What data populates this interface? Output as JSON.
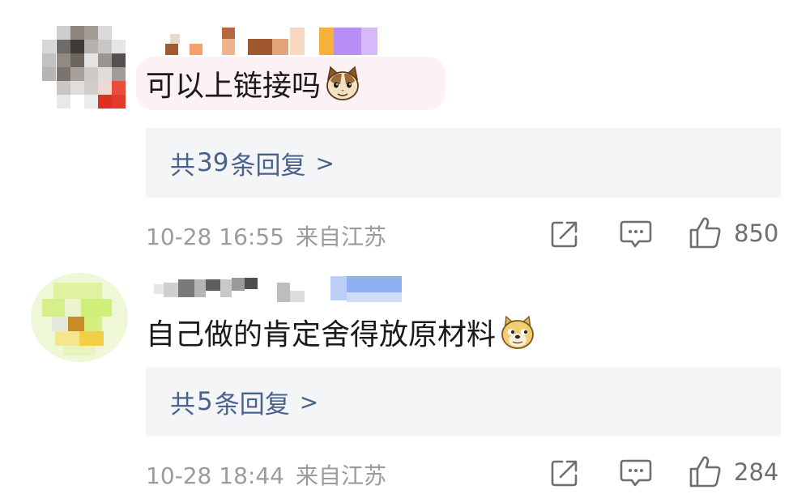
{
  "comments": [
    {
      "text": "可以上链接吗",
      "emoji": "cat-face-emoji",
      "replies_prefix": "共",
      "replies_count": "39",
      "replies_suffix": "条回复",
      "replies_chevron": ">",
      "time": "10-28 16:55",
      "location": "来自江苏",
      "likes": "850"
    },
    {
      "text": "自己做的肯定舍得放原材料",
      "emoji": "doge-face-emoji",
      "replies_prefix": "共",
      "replies_count": "5",
      "replies_suffix": "条回复",
      "replies_chevron": ">",
      "time": "10-28 18:44",
      "location": "来自江苏",
      "likes": "284"
    }
  ],
  "colors": {
    "reply_link": "#48628d",
    "meta_text": "#9b9b9b",
    "reply_box_bg": "#f4f5f7",
    "bubble_bg": "#fcf1f4"
  },
  "icons": [
    "share-icon",
    "comment-icon",
    "thumbs-up-icon"
  ]
}
